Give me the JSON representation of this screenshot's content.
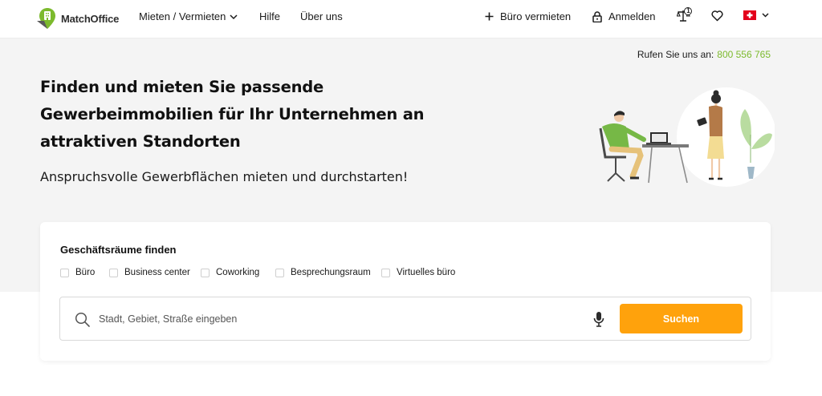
{
  "header": {
    "logo_text": "MatchOffice",
    "nav": {
      "rent": "Mieten / Vermieten",
      "help": "Hilfe",
      "about": "Über uns"
    },
    "list_office": "Büro vermieten",
    "login": "Anmelden",
    "compare_count": "1",
    "country_flag": "switzerland-flag-icon"
  },
  "hero": {
    "phone_label": "Rufen Sie uns an:",
    "phone_number": "800 556 765",
    "title": "Finden und mieten Sie passende Gewerbeimmobilien für Ihr Unternehmen an attraktiven Standorten",
    "subtitle": "Anspruchsvolle Gewerbflächen mieten und durchstarten!"
  },
  "search_card": {
    "title": "Geschäftsräume finden",
    "types": [
      {
        "label": "Büro",
        "checked": false
      },
      {
        "label": "Business center",
        "checked": false
      },
      {
        "label": "Coworking",
        "checked": false
      },
      {
        "label": "Besprechungsraum",
        "checked": false
      },
      {
        "label": "Virtuelles büro",
        "checked": false
      }
    ],
    "placeholder": "Stadt, Gebiet, Straße eingeben",
    "button": "Suchen"
  },
  "colors": {
    "accent_green": "#7cba2d",
    "search_button": "#ffa20c",
    "hero_bg": "#f4f4f4"
  }
}
